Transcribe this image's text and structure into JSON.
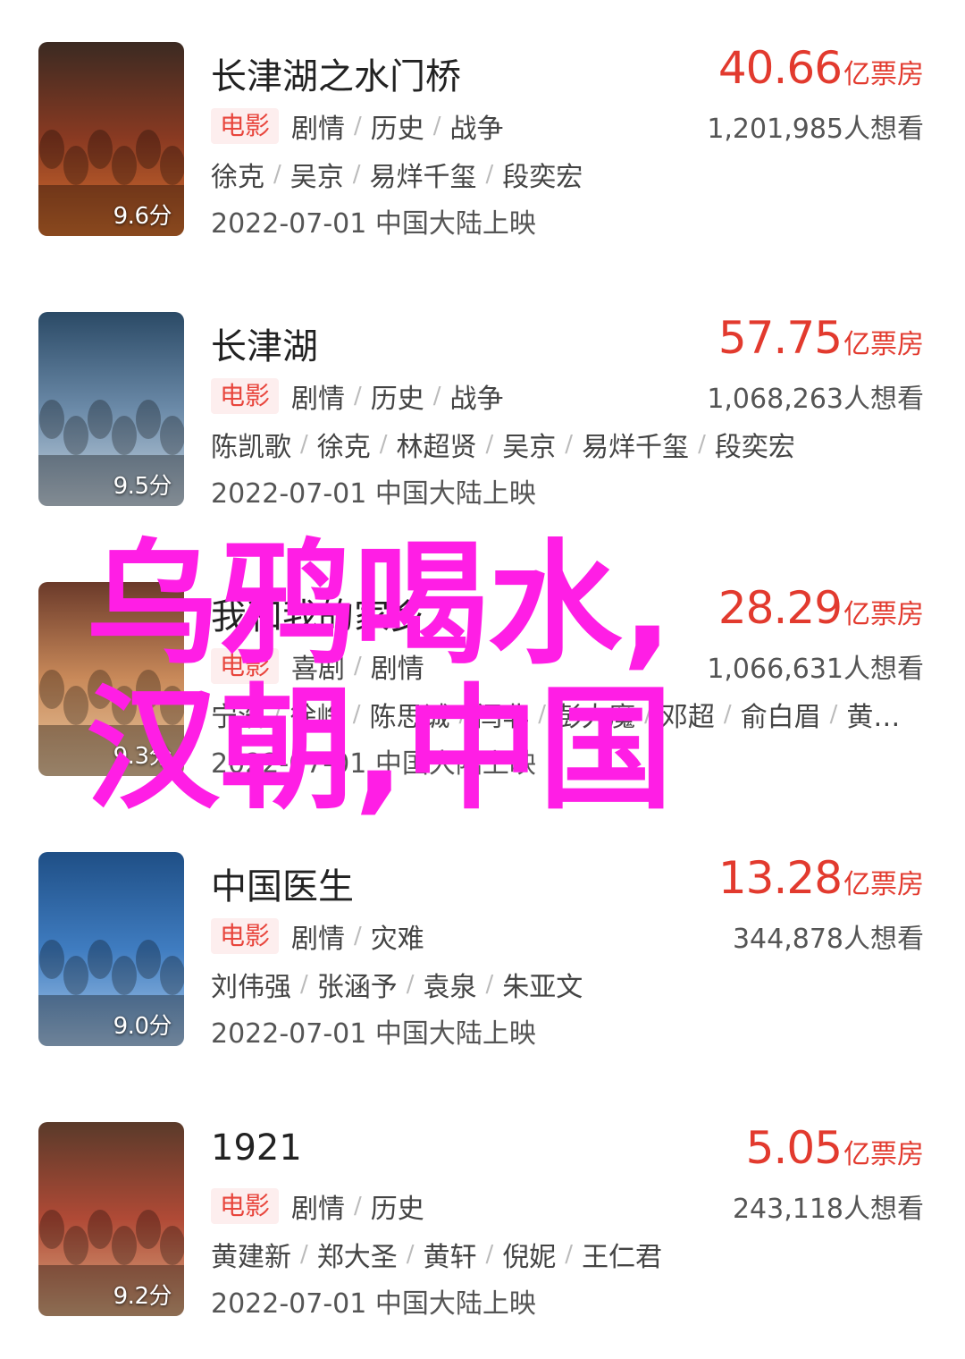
{
  "movies": [
    {
      "title": "长津湖之水门桥",
      "score": "9.6分",
      "tag": "电影",
      "genres": [
        "剧情",
        "历史",
        "战争"
      ],
      "cast": [
        "徐克",
        "吴京",
        "易烊千玺",
        "段奕宏"
      ],
      "release": "2022-07-01 中国大陆上映",
      "box_office": "40.66",
      "box_unit": "亿票房",
      "wish": "1,201,985人想看",
      "poster_colors": [
        "#3b2a22",
        "#8a3a22",
        "#d4702e"
      ]
    },
    {
      "title": "长津湖",
      "score": "9.5分",
      "tag": "电影",
      "genres": [
        "剧情",
        "历史",
        "战争"
      ],
      "cast": [
        "陈凯歌",
        "徐克",
        "林超贤",
        "吴京",
        "易烊千玺",
        "段奕宏"
      ],
      "release": "2022-07-01 中国大陆上映",
      "box_office": "57.75",
      "box_unit": "亿票房",
      "wish": "1,068,263人想看",
      "poster_colors": [
        "#2b4a66",
        "#6b8aa8",
        "#c8d6e2"
      ]
    },
    {
      "title": "我和我的家乡",
      "score": "9.3分",
      "tag": "电影",
      "genres": [
        "喜剧",
        "剧情"
      ],
      "cast": [
        "宁浩",
        "徐峥",
        "陈思诚",
        "闫非",
        "彭大魔",
        "邓超",
        "俞白眉",
        "黄…"
      ],
      "release": "2022-07-01 中国大陆上映",
      "box_office": "28.29",
      "box_unit": "亿票房",
      "wish": "1,066,631人想看",
      "poster_colors": [
        "#6b3a2a",
        "#c98a5a",
        "#e8c7a0"
      ]
    },
    {
      "title": "中国医生",
      "score": "9.0分",
      "tag": "电影",
      "genres": [
        "剧情",
        "灾难"
      ],
      "cast": [
        "刘伟强",
        "张涵予",
        "袁泉",
        "朱亚文"
      ],
      "release": "2022-07-01 中国大陆上映",
      "box_office": "13.28",
      "box_unit": "亿票房",
      "wish": "344,878人想看",
      "poster_colors": [
        "#1f4f86",
        "#3f7cc0",
        "#a9c9ea"
      ]
    },
    {
      "title": "1921",
      "score": "9.2分",
      "tag": "电影",
      "genres": [
        "剧情",
        "历史"
      ],
      "cast": [
        "黄建新",
        "郑大圣",
        "黄轩",
        "倪妮",
        "王仁君"
      ],
      "release": "2022-07-01 中国大陆上映",
      "box_office": "5.05",
      "box_unit": "亿票房",
      "wish": "243,118人想看",
      "poster_colors": [
        "#5a3a2a",
        "#b04a36",
        "#d9a880"
      ]
    }
  ],
  "overlay": {
    "line1": "乌鸦喝水,",
    "line2": "汉朝,中国",
    "color": "#ff1ee5"
  }
}
